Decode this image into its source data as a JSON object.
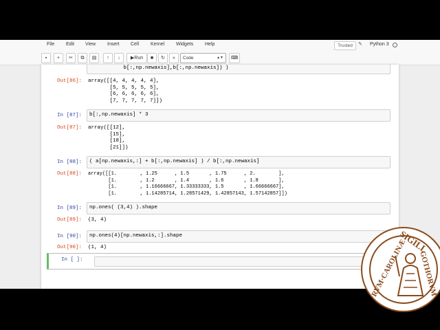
{
  "menu": [
    "File",
    "Edit",
    "View",
    "Insert",
    "Cell",
    "Kernel",
    "Widgets",
    "Help"
  ],
  "trusted_label": "Trusted",
  "kernel_name": "Python 3",
  "toolbar": {
    "run_label": "Run",
    "cell_type": "Code"
  },
  "cells": {
    "c86": {
      "code_tail": "           b[:,np.newaxis],b[:,np.newaxis]) )",
      "out_prompt": "Out[86]:",
      "output": "array([[4, 4, 4, 4, 4],\n       [5, 5, 5, 5, 5],\n       [6, 6, 6, 6, 6],\n       [7, 7, 7, 7, 7]])"
    },
    "c87": {
      "in_prompt": "In [87]:",
      "code": "b[:,np.newaxis] * 3",
      "out_prompt": "Out[87]:",
      "output": "array([[12],\n       [15],\n       [18],\n       [21]])"
    },
    "c88": {
      "in_prompt": "In [88]:",
      "code": "( a[np.newaxis,:] + b[:,np.newaxis] ) / b[:,np.newaxis]",
      "out_prompt": "Out[88]:",
      "output": "array([[1.        , 1.25      , 1.5       , 1.75      , 2.        ],\n       [1.        , 1.2       , 1.4       , 1.6       , 1.8       ],\n       [1.        , 1.16666667, 1.33333333, 1.5       , 1.66666667],\n       [1.        , 1.14285714, 1.28571429, 1.42857143, 1.57142857]])"
    },
    "c89": {
      "in_prompt": "In [89]:",
      "code": "np.ones( (3,4) ).shape",
      "out_prompt": "Out[89]:",
      "output": "(3, 4)"
    },
    "c90": {
      "in_prompt": "In [90]:",
      "code": "np.ones(4)[np.newaxis,:].shape",
      "out_prompt": "Out[90]:",
      "output": "(1, 4)"
    },
    "empty": {
      "in_prompt": "In [ ]:"
    }
  },
  "seal": {
    "text_top": "SIGILL",
    "text_left": "RVM·CAROLINÆ",
    "text_right": "GOTHORVM"
  },
  "colors": {
    "in_prompt": "#303f9f",
    "out_prompt": "#d84315",
    "active_border": "#66bb6a",
    "seal": "#8a4a1a"
  }
}
